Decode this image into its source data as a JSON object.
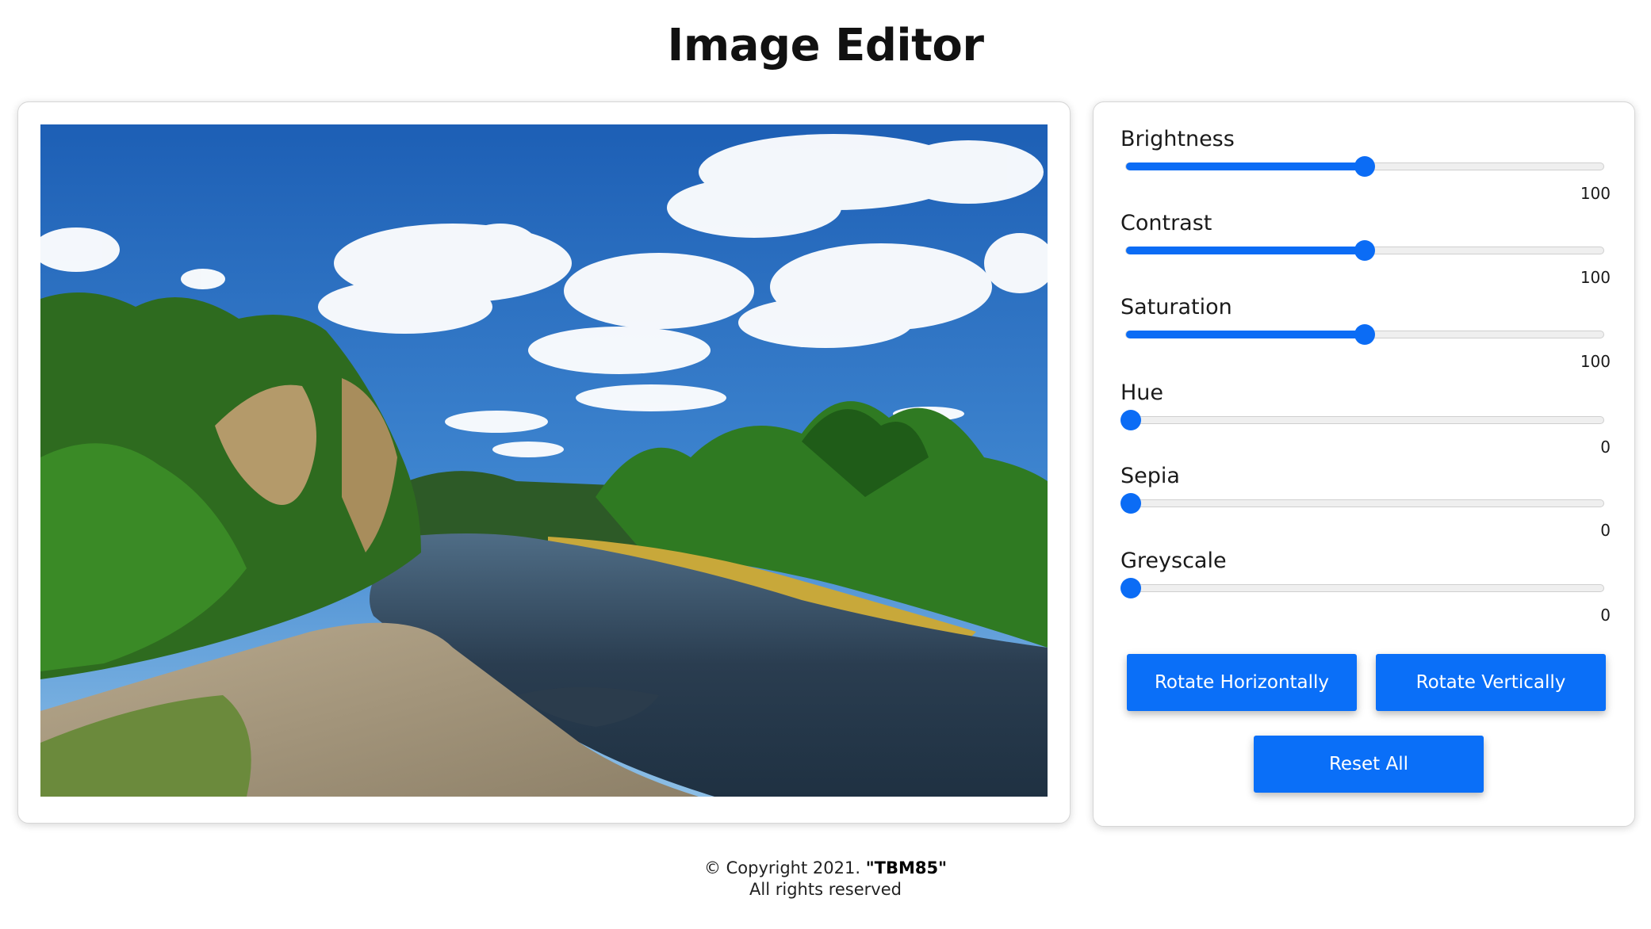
{
  "page": {
    "title": "Image Editor"
  },
  "image": {
    "description_icon": "landscape-photo",
    "colors": {
      "sky_top": "#1e62b8",
      "sky_bottom": "#6aa8df",
      "foliage": "#2f7a22",
      "water": "#2c3f52",
      "sand": "#a89a80"
    }
  },
  "sliders": [
    {
      "label": "Brightness",
      "value": "100",
      "fraction": 0.5
    },
    {
      "label": "Contrast",
      "value": "100",
      "fraction": 0.5
    },
    {
      "label": "Saturation",
      "value": "100",
      "fraction": 0.5
    },
    {
      "label": "Hue",
      "value": "0",
      "fraction": 0
    },
    {
      "label": "Sepia",
      "value": "0",
      "fraction": 0
    },
    {
      "label": "Greyscale",
      "value": "0",
      "fraction": 0
    }
  ],
  "buttons": {
    "rotate_horizontal": "Rotate Horizontally",
    "rotate_vertical": "Rotate Vertically",
    "reset_all": "Reset All"
  },
  "footer": {
    "copyright": "© Copyright 2021.",
    "author": "\"TBM85\"",
    "rights": "All rights reserved"
  },
  "colors": {
    "accent": "#0a6ff8",
    "track": "#efefef",
    "card_border": "#d6d6d6"
  }
}
